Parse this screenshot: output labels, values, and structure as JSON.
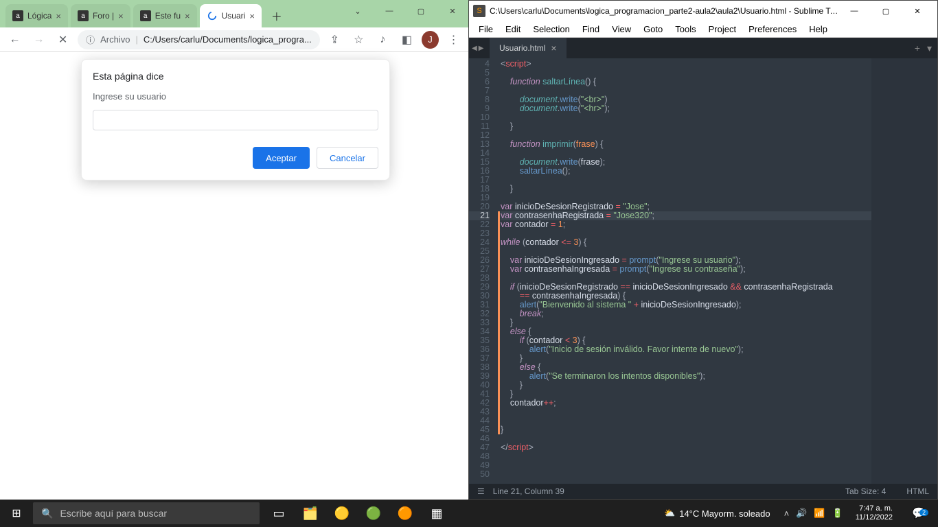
{
  "chrome": {
    "tabs": [
      {
        "label": "Lógica"
      },
      {
        "label": "Foro |"
      },
      {
        "label": "Este fu"
      },
      {
        "label": "Usuari"
      }
    ],
    "toolbar": {
      "file_label": "Archivo",
      "url": "C:/Users/carlu/Documents/logica_progra...",
      "avatar_initial": "J"
    },
    "dialog": {
      "title": "Esta página dice",
      "message": "Ingrese su usuario",
      "ok": "Aceptar",
      "cancel": "Cancelar"
    }
  },
  "sublime": {
    "title": "C:\\Users\\carlu\\Documents\\logica_programacion_parte2-aula2\\aula2\\Usuario.html - Sublime Te...",
    "menus": [
      "File",
      "Edit",
      "Selection",
      "Find",
      "View",
      "Goto",
      "Tools",
      "Project",
      "Preferences",
      "Help"
    ],
    "tab": "Usuario.html",
    "status": {
      "pos": "Line 21, Column 39",
      "tabsize": "Tab Size: 4",
      "lang": "HTML"
    },
    "gutter_start": 4,
    "gutter_end": 50,
    "active_line": 21,
    "code": {
      "var_login_reg": "inicioDeSesionRegistrado",
      "var_login_reg_val": "\"Jose\"",
      "var_pass_reg": "contrasenhaRegistrada",
      "var_pass_reg_val": "\"Jose320\"",
      "var_contador": "contador",
      "str_ingrese_usuario": "\"Ingrese su usuario\"",
      "str_ingrese_pass": "\"Ingrese su contraseña\"",
      "str_bienvenido": "\"Bienvenido al sistema \"",
      "str_invalido": "\"Inicio de sesión inválido. Favor intente de nuevo\"",
      "str_terminado": "\"Se terminaron los intentos disponibles\""
    }
  },
  "taskbar": {
    "search_placeholder": "Escribe aquí para buscar",
    "weather": "14°C  Mayorm. soleado",
    "time": "7:47 a. m.",
    "date": "11/12/2022",
    "notif_count": "2"
  }
}
